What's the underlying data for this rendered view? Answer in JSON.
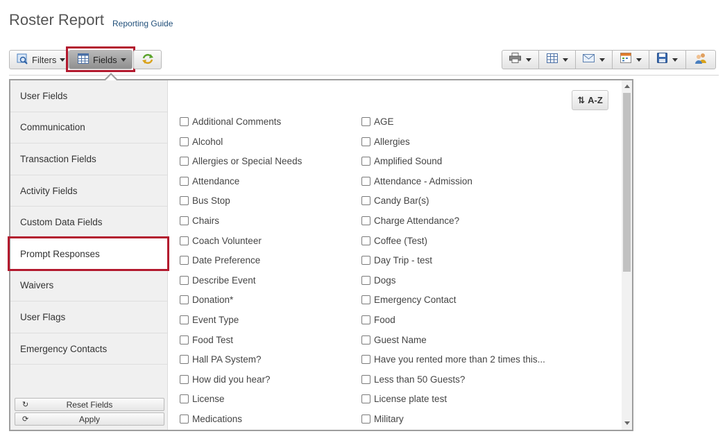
{
  "page": {
    "title": "Roster Report",
    "guide_link": "Reporting Guide"
  },
  "toolbar": {
    "filters_label": "Filters",
    "fields_label": "Fields"
  },
  "sidebar": {
    "items": [
      {
        "label": "User Fields"
      },
      {
        "label": "Communication"
      },
      {
        "label": "Transaction Fields"
      },
      {
        "label": "Activity Fields"
      },
      {
        "label": "Custom Data Fields"
      },
      {
        "label": "Prompt Responses"
      },
      {
        "label": "Waivers"
      },
      {
        "label": "User Flags"
      },
      {
        "label": "Emergency Contacts"
      }
    ],
    "reset_label": "Reset Fields",
    "apply_label": "Apply"
  },
  "sort_button": {
    "label": "A-Z"
  },
  "fields": {
    "col1": [
      "Additional Comments",
      "Alcohol",
      "Allergies or Special Needs",
      "Attendance",
      "Bus Stop",
      "Chairs",
      "Coach Volunteer",
      "Date Preference",
      "Describe Event",
      "Donation*",
      "Event Type",
      "Food Test",
      "Hall PA System?",
      "How did you hear?",
      "License",
      "Medications"
    ],
    "col2": [
      "AGE",
      "Allergies",
      "Amplified Sound",
      "Attendance - Admission",
      "Candy Bar(s)",
      "Charge Attendance?",
      "Coffee (Test)",
      "Day Trip - test",
      "Dogs",
      "Emergency Contact",
      "Food",
      "Guest Name",
      "Have you rented more than 2 times this...",
      "Less than 50 Guests?",
      "License plate test",
      "Military"
    ]
  },
  "colors": {
    "highlight": "#b3192e"
  }
}
